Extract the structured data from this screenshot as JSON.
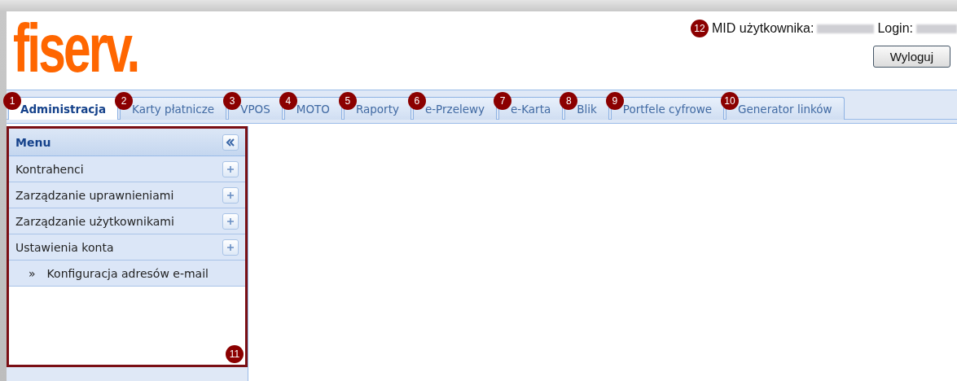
{
  "header": {
    "logo": "fiserv.",
    "user_info": {
      "badge": "12",
      "mid_label": "MID użytkownika:",
      "login_label": "Login:"
    },
    "logout_button": "Wyloguj"
  },
  "tabs": [
    {
      "label": "Administracja",
      "badge": "1",
      "selected": true
    },
    {
      "label": "Karty płatnicze",
      "badge": "2",
      "selected": false
    },
    {
      "label": "VPOS",
      "badge": "3",
      "selected": false
    },
    {
      "label": "MOTO",
      "badge": "4",
      "selected": false
    },
    {
      "label": "Raporty",
      "badge": "5",
      "selected": false
    },
    {
      "label": "e-Przelewy",
      "badge": "6",
      "selected": false
    },
    {
      "label": "e-Karta",
      "badge": "7",
      "selected": false
    },
    {
      "label": "Blik",
      "badge": "8",
      "selected": false
    },
    {
      "label": "Portfele cyfrowe",
      "badge": "9",
      "selected": false
    },
    {
      "label": "Generator linków",
      "badge": "10",
      "selected": false
    }
  ],
  "menu": {
    "title": "Menu",
    "badge": "11",
    "items": [
      {
        "label": "Kontrahenci",
        "kind": "group"
      },
      {
        "label": "Zarządzanie uprawnieniami",
        "kind": "group"
      },
      {
        "label": "Zarządzanie użytkownikami",
        "kind": "group"
      },
      {
        "label": "Ustawienia konta",
        "kind": "group"
      },
      {
        "label": "Konfiguracja adresów e-mail",
        "kind": "link",
        "bullet": "»"
      }
    ]
  }
}
